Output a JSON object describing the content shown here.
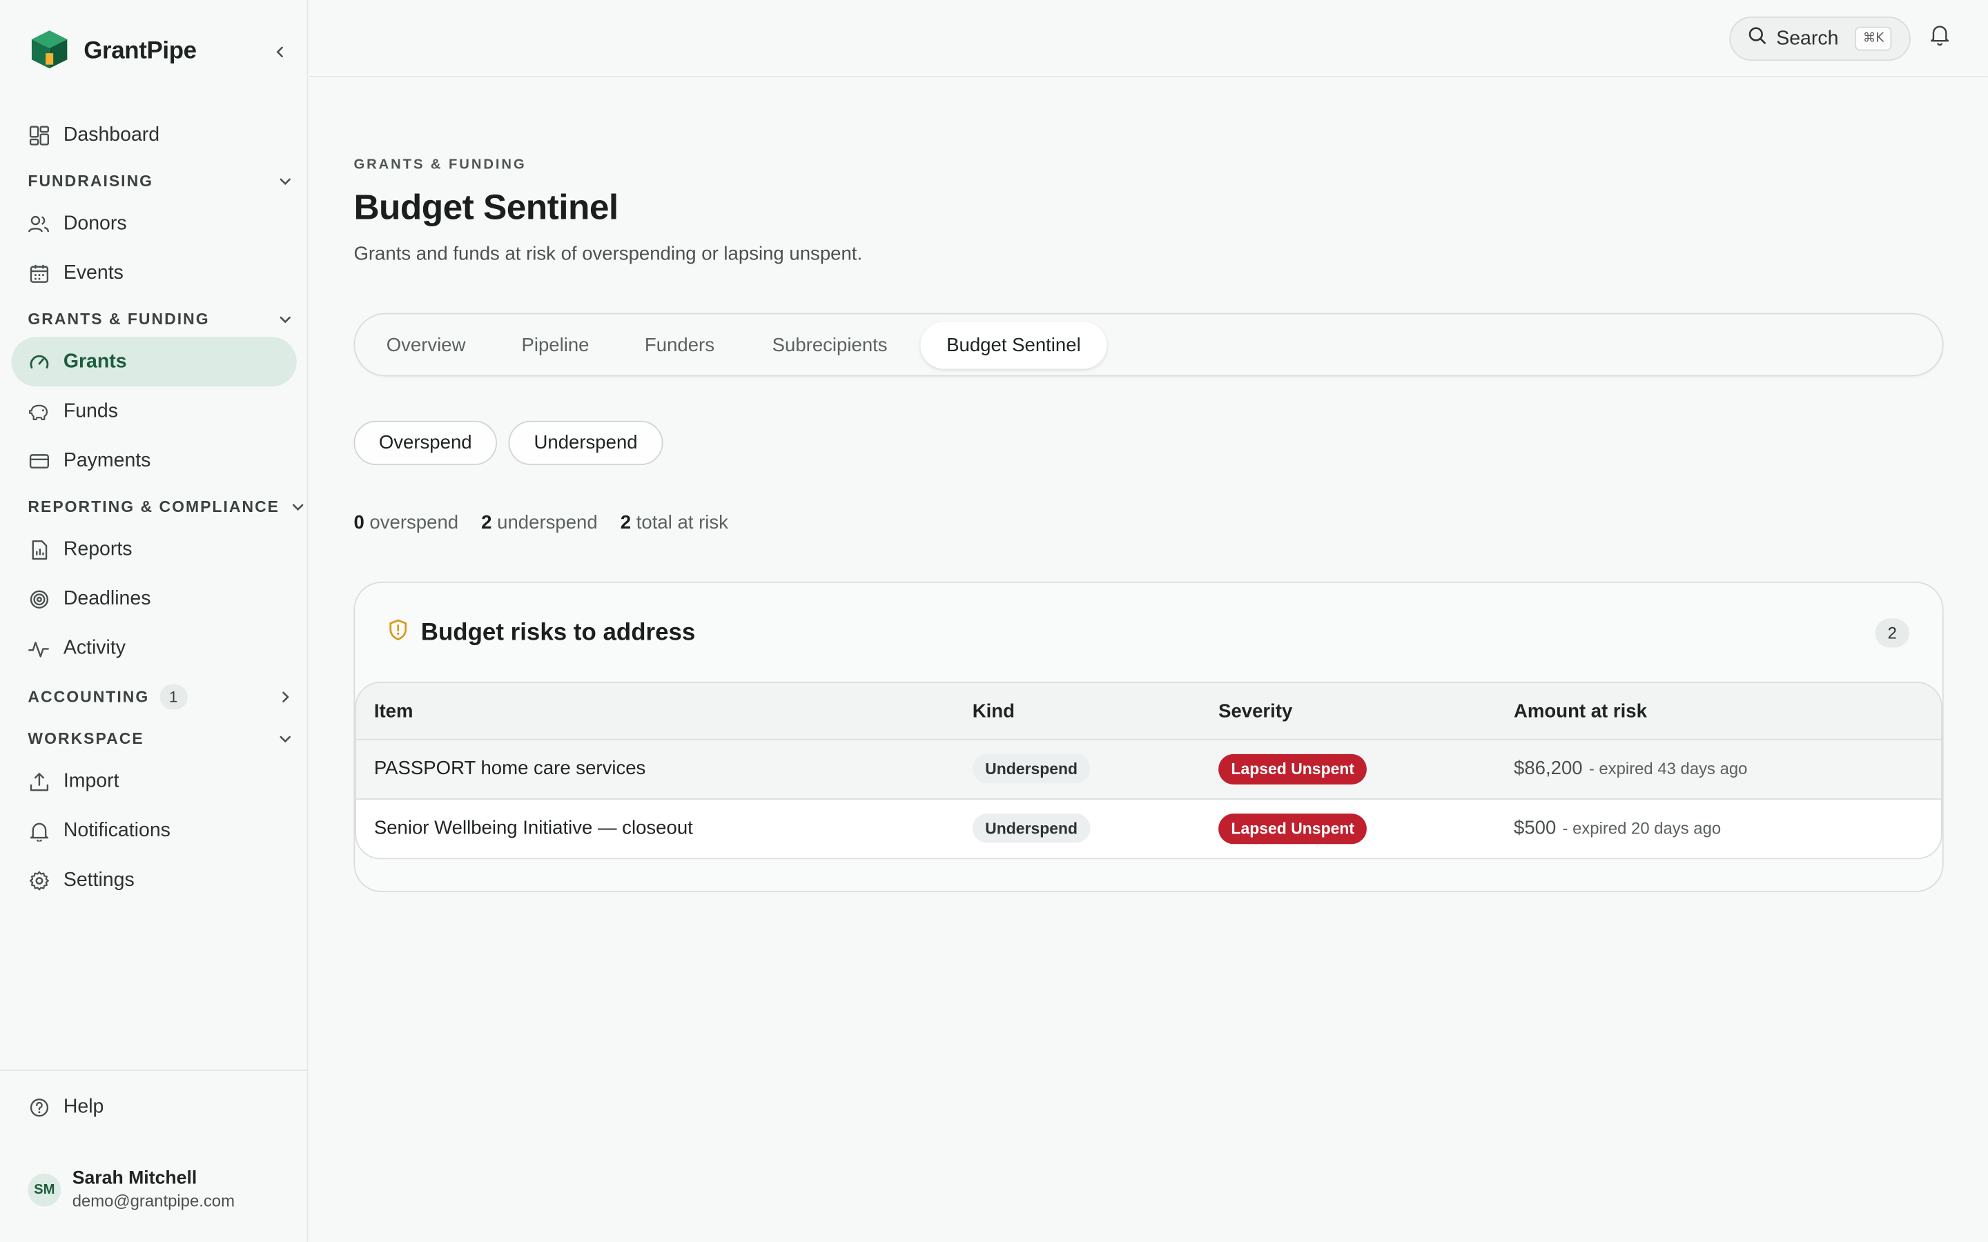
{
  "brand": {
    "name": "GrantPipe"
  },
  "sidebar": {
    "dashboard": "Dashboard",
    "sections": {
      "fundraising": "FUNDRAISING",
      "grants_funding": "GRANTS & FUNDING",
      "reporting": "REPORTING & COMPLIANCE",
      "accounting": "ACCOUNTING",
      "accounting_count": "1",
      "workspace": "WORKSPACE"
    },
    "items": {
      "donors": "Donors",
      "events": "Events",
      "grants": "Grants",
      "funds": "Funds",
      "payments": "Payments",
      "reports": "Reports",
      "deadlines": "Deadlines",
      "activity": "Activity",
      "import": "Import",
      "notifications": "Notifications",
      "settings": "Settings",
      "help": "Help"
    },
    "user": {
      "initials": "SM",
      "name": "Sarah Mitchell",
      "email": "demo@grantpipe.com"
    }
  },
  "topbar": {
    "search_label": "Search",
    "search_shortcut": "⌘K"
  },
  "page": {
    "eyebrow": "GRANTS & FUNDING",
    "title": "Budget Sentinel",
    "subtitle": "Grants and funds at risk of overspending or lapsing unspent."
  },
  "tabs": [
    "Overview",
    "Pipeline",
    "Funders",
    "Subrecipients",
    "Budget Sentinel"
  ],
  "active_tab": "Budget Sentinel",
  "filters": [
    "Overspend",
    "Underspend"
  ],
  "stats": [
    {
      "value": "0",
      "label": "overspend"
    },
    {
      "value": "2",
      "label": "underspend"
    },
    {
      "value": "2",
      "label": "total at risk"
    }
  ],
  "card": {
    "title": "Budget risks to address",
    "count": "2"
  },
  "table": {
    "headers": [
      "Item",
      "Kind",
      "Severity",
      "Amount at risk"
    ],
    "rows": [
      {
        "item": "PASSPORT home care services",
        "kind": "Underspend",
        "severity": "Lapsed Unspent",
        "amount": "$86,200",
        "note": "- expired 43 days ago"
      },
      {
        "item": "Senior Wellbeing Initiative — closeout",
        "kind": "Underspend",
        "severity": "Lapsed Unspent",
        "amount": "$500",
        "note": "- expired 20 days ago"
      }
    ]
  },
  "colors": {
    "accent": "#1d5c3e",
    "active_bg": "#dcebe4",
    "danger": "#c0202e",
    "warning_icon": "#d99a1c"
  }
}
